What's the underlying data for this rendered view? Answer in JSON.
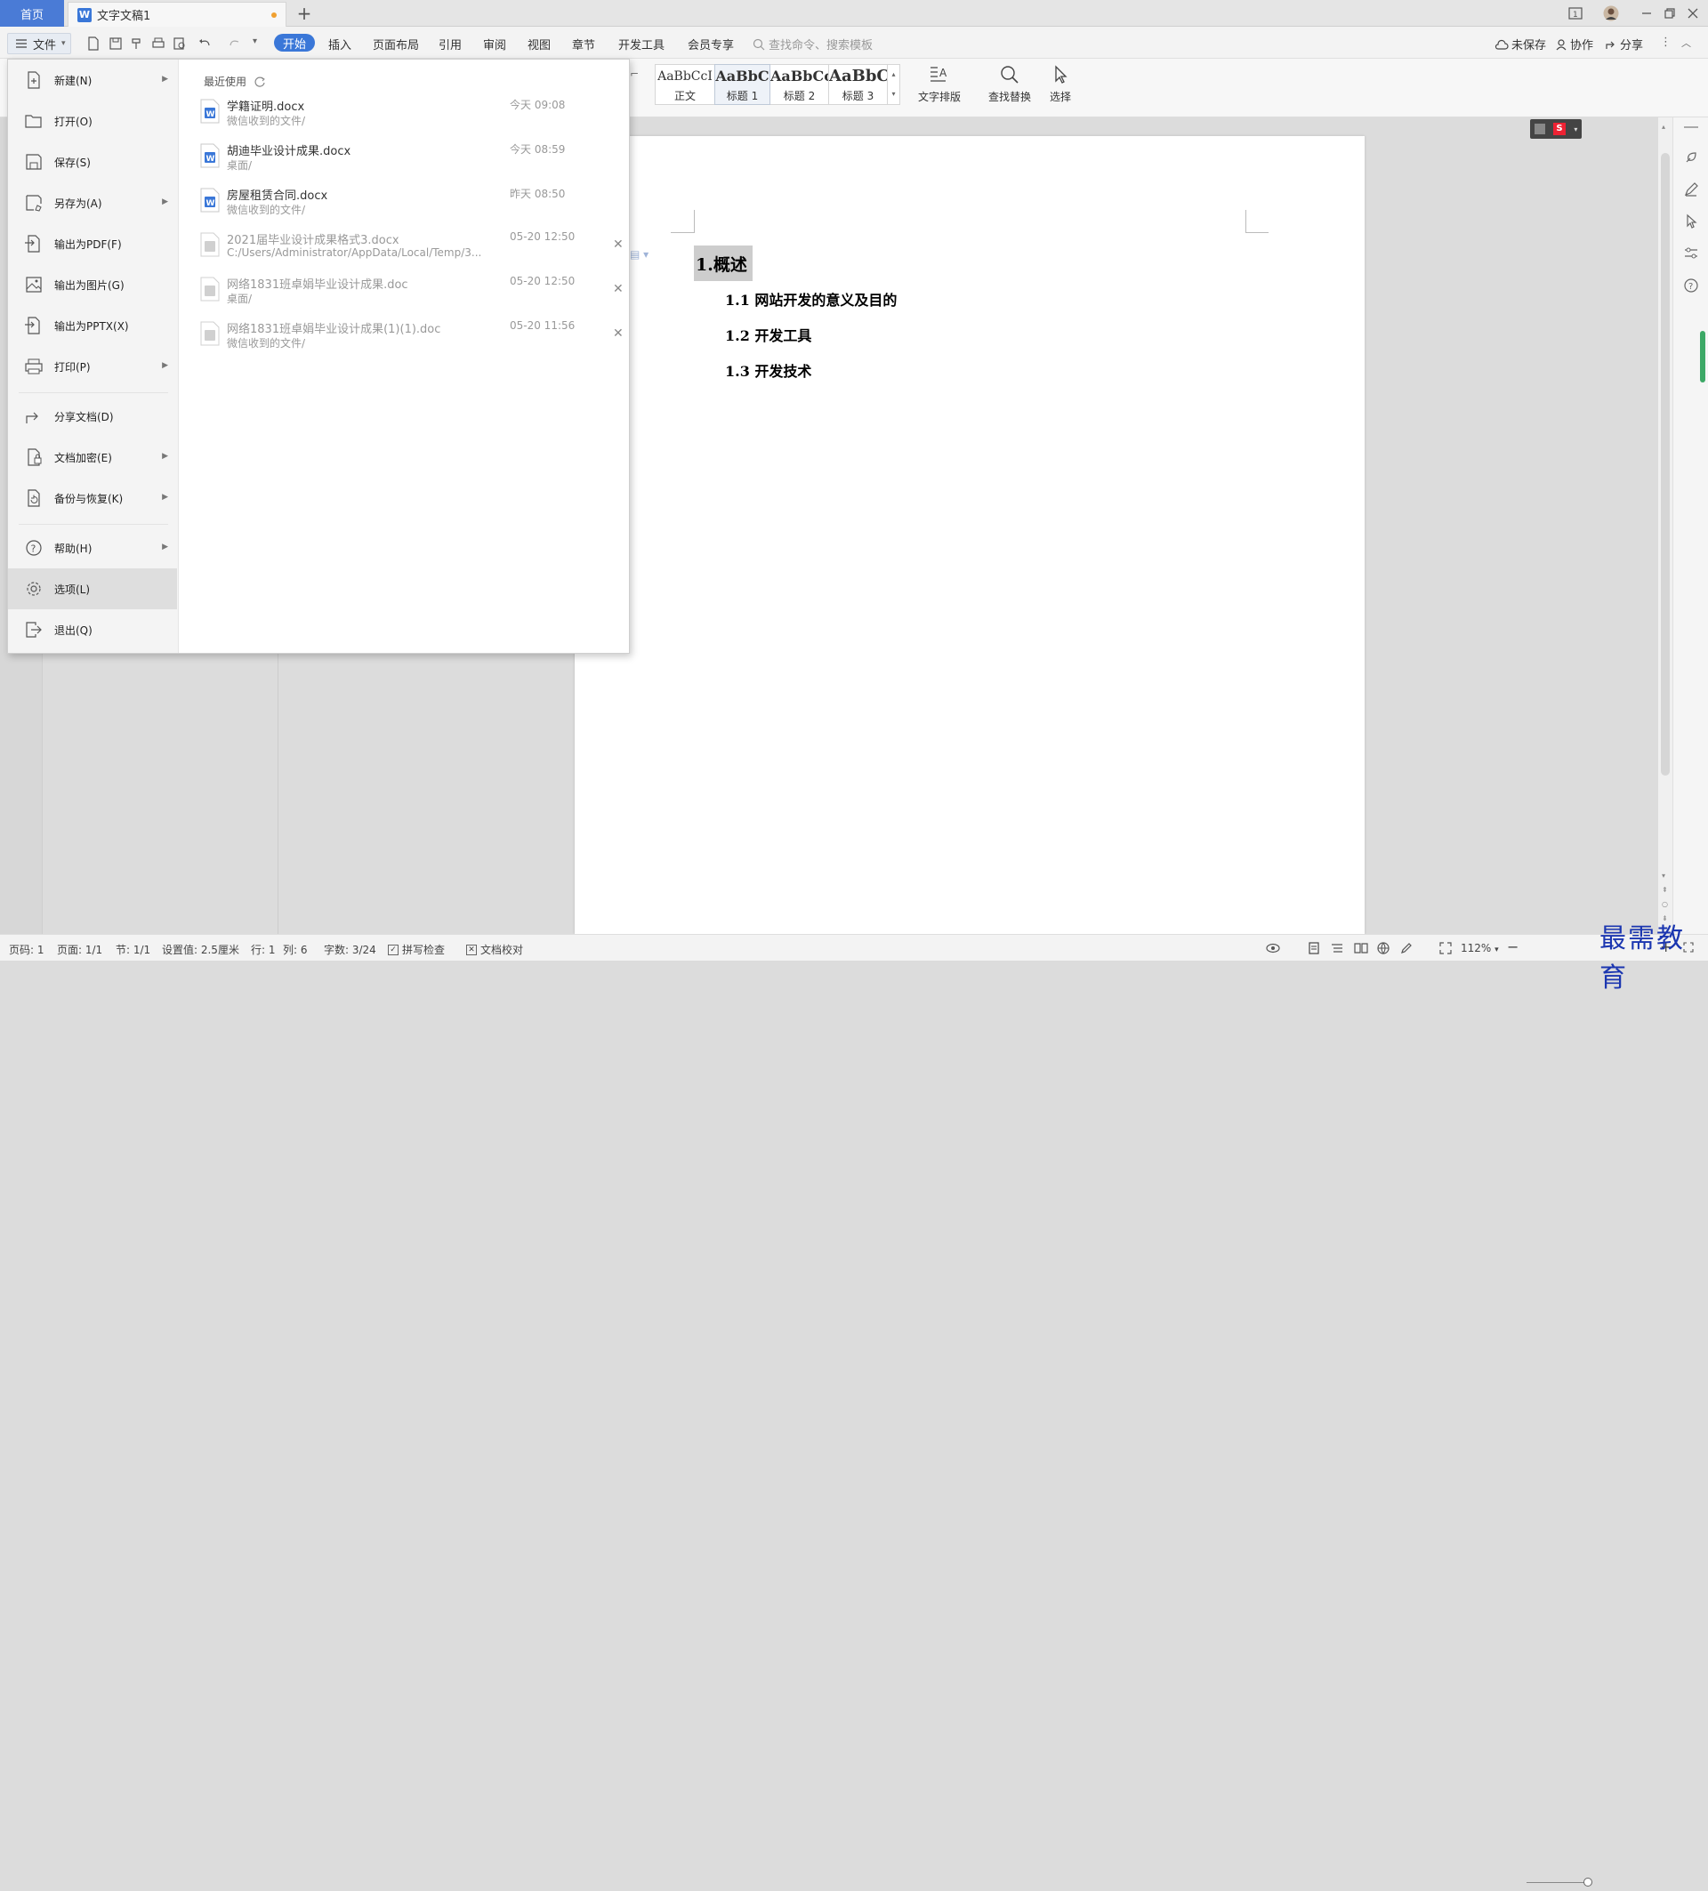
{
  "titlebar": {
    "home_tab": "首页",
    "doc_tab": "文字文稿1",
    "doc_icon": "W"
  },
  "menubar": {
    "file_label": "文件",
    "tabs": [
      "开始",
      "插入",
      "页面布局",
      "引用",
      "审阅",
      "视图",
      "章节",
      "开发工具",
      "会员专享"
    ],
    "search_placeholder": "查找命令、搜索模板",
    "unsaved": "未保存",
    "collab": "协作",
    "share": "分享"
  },
  "ribbon": {
    "styles": [
      {
        "preview": "AaBbCcI",
        "name": "正文"
      },
      {
        "preview": "AaBbC",
        "name": "标题 1"
      },
      {
        "preview": "AaBbCc",
        "name": "标题 2"
      },
      {
        "preview": "AaBbC",
        "name": "标题 3"
      }
    ],
    "text_layout": "文字排版",
    "find_replace": "查找替换",
    "select": "选择"
  },
  "filemenu": {
    "items": [
      {
        "label": "新建(N)",
        "icon": "new-icon",
        "arrow": true
      },
      {
        "label": "打开(O)",
        "icon": "open-folder-icon",
        "arrow": false
      },
      {
        "label": "保存(S)",
        "icon": "save-icon",
        "arrow": false
      },
      {
        "label": "另存为(A)",
        "icon": "save-as-icon",
        "arrow": true
      },
      {
        "label": "输出为PDF(F)",
        "icon": "pdf-icon",
        "arrow": false
      },
      {
        "label": "输出为图片(G)",
        "icon": "image-icon",
        "arrow": false
      },
      {
        "label": "输出为PPTX(X)",
        "icon": "pptx-icon",
        "arrow": false
      },
      {
        "label": "打印(P)",
        "icon": "print-icon",
        "arrow": true
      },
      {
        "label": "分享文档(D)",
        "icon": "share-icon",
        "arrow": false
      },
      {
        "label": "文档加密(E)",
        "icon": "lock-icon",
        "arrow": true
      },
      {
        "label": "备份与恢复(K)",
        "icon": "backup-icon",
        "arrow": true
      },
      {
        "label": "帮助(H)",
        "icon": "help-icon",
        "arrow": true
      },
      {
        "label": "选项(L)",
        "icon": "gear-icon",
        "arrow": false
      },
      {
        "label": "退出(Q)",
        "icon": "exit-icon",
        "arrow": false
      }
    ],
    "recent_title": "最近使用",
    "recent": [
      {
        "name": "学籍证明.docx",
        "path": "微信收到的文件/",
        "time": "今天 09:08",
        "closable": false,
        "dim": false
      },
      {
        "name": "胡迪毕业设计成果.docx",
        "path": "桌面/",
        "time": "今天 08:59",
        "closable": false,
        "dim": false
      },
      {
        "name": "房屋租赁合同.docx",
        "path": "微信收到的文件/",
        "time": "昨天 08:50",
        "closable": false,
        "dim": false
      },
      {
        "name": "2021届毕业设计成果格式3.docx",
        "path": "C:/Users/Administrator/AppData/Local/Temp/3...",
        "time": "05-20 12:50",
        "closable": true,
        "dim": true
      },
      {
        "name": "网络1831班卓娟毕业设计成果.doc",
        "path": "桌面/",
        "time": "05-20 12:50",
        "closable": true,
        "dim": true
      },
      {
        "name": "网络1831班卓娟毕业设计成果(1)(1).doc",
        "path": "微信收到的文件/",
        "time": "05-20 11:56",
        "closable": true,
        "dim": true
      }
    ]
  },
  "document": {
    "heading1": "1.概述",
    "subheadings": [
      "1.1 网站开发的意义及目的",
      "1.2 开发工具",
      "1.3 开发技术"
    ]
  },
  "statusbar": {
    "page_code": "页码: 1",
    "page": "页面: 1/1",
    "section": "节: 1/1",
    "setting": "设置值: 2.5厘米",
    "row": "行: 1",
    "col": "列: 6",
    "words": "字数: 3/24",
    "spell": "拼写检查",
    "proof": "文档校对",
    "zoom": "112%"
  },
  "watermark": "最需教育"
}
